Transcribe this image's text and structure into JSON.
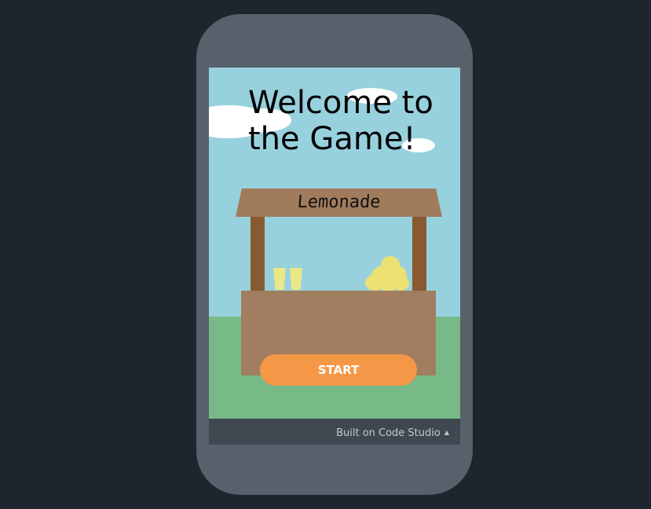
{
  "game": {
    "title": "Welcome to the Game!",
    "stand_sign": "Lemonade",
    "start_button_label": "START"
  },
  "footer": {
    "built_on_label": "Built on Code Studio",
    "caret_icon": "▲"
  },
  "colors": {
    "page_background": "#1f252d",
    "phone_frame": "#56616b",
    "sky": "#98d1de",
    "grass": "#77ba88",
    "stand_wood": "#a07e5f",
    "stand_posts": "#875a31",
    "lemon": "#ebe171",
    "cup": "#eae787",
    "start_button": "#f49847",
    "footer_bar": "#3f4850"
  },
  "icons": [
    "cloud-icon",
    "cup-icon",
    "lemon-icon",
    "caret-up-icon"
  ]
}
